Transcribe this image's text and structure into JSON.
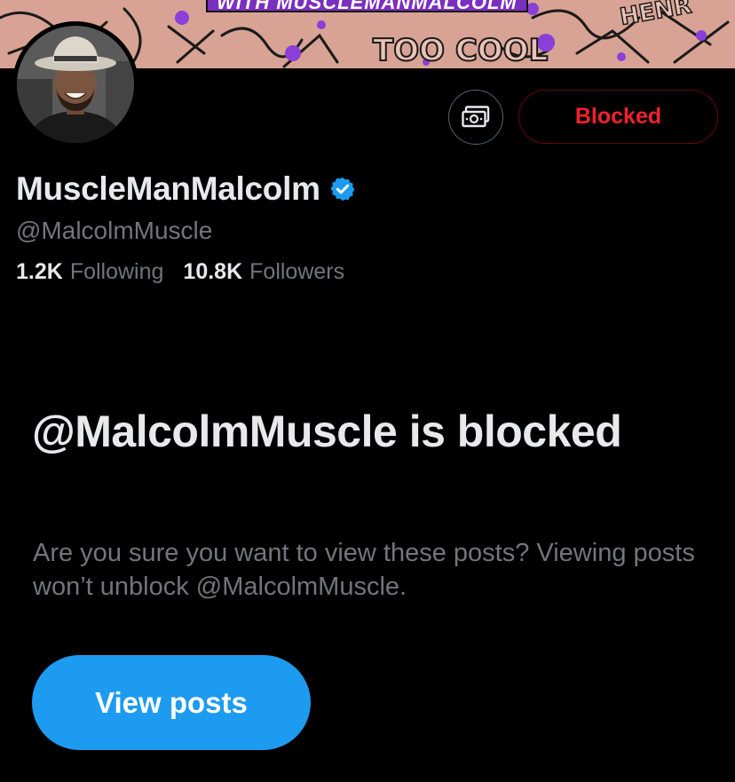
{
  "banner": {
    "title": "WITH MUSCLEMANMALCOLM",
    "accent_color": "#7b2fbe"
  },
  "profile": {
    "display_name": "MuscleManMalcolm",
    "verified": true,
    "verified_icon": "verified-badge-icon",
    "handle": "@MalcolmMuscle",
    "following_count": "1.2K",
    "following_label": "Following",
    "followers_count": "10.8K",
    "followers_label": "Followers"
  },
  "actions": {
    "tip_icon": "money-icon",
    "blocked_label": "Blocked",
    "blocked_color": "#f4212e"
  },
  "blocked_notice": {
    "heading": "@MalcolmMuscle is blocked",
    "description": "Are you sure you want to view these posts? Viewing posts won’t unblock @MalcolmMuscle.",
    "view_posts_label": "View posts",
    "button_color": "#1d9bf0"
  }
}
